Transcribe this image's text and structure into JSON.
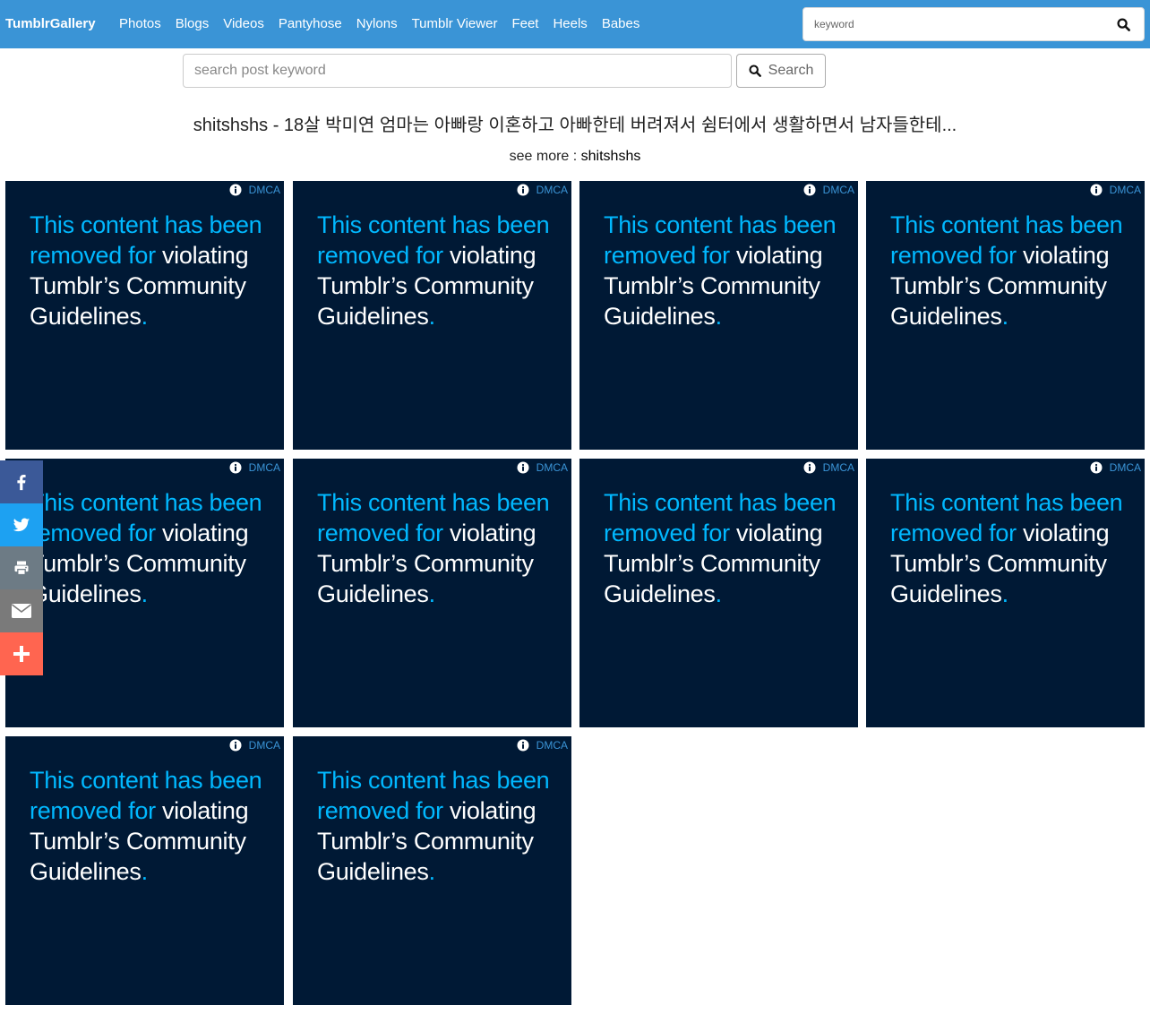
{
  "nav": {
    "brand": "TumblrGallery",
    "links": [
      "Photos",
      "Blogs",
      "Videos",
      "Pantyhose",
      "Nylons",
      "Tumblr Viewer",
      "Feet",
      "Heels",
      "Babes"
    ],
    "search_placeholder": "keyword",
    "search_icon": "search-icon"
  },
  "post_search": {
    "placeholder": "search post keyword",
    "button_label": "Search"
  },
  "title": "shitshshs - 18살 박미연 엄마는 아빠랑 이혼하고 아빠한테 버려져서 쉼터에서 생활하면서 남자들한테...",
  "see_more": {
    "label": "see more : ",
    "link": "shitshshs"
  },
  "tile_common": {
    "dmca": "DMCA",
    "notice_parts": {
      "a": "This content has been removed for",
      "b": " violating Tumblr’s Community Guidelines",
      "c": "."
    }
  },
  "tiles_count": 10,
  "share": [
    {
      "icon": "facebook-icon",
      "color": "#3b5998"
    },
    {
      "icon": "twitter-icon",
      "color": "#1da1f2"
    },
    {
      "icon": "print-icon",
      "color": "#6d7b85"
    },
    {
      "icon": "email-icon",
      "color": "#7a7a7a"
    },
    {
      "icon": "plus-icon",
      "color": "#ff6550"
    }
  ]
}
